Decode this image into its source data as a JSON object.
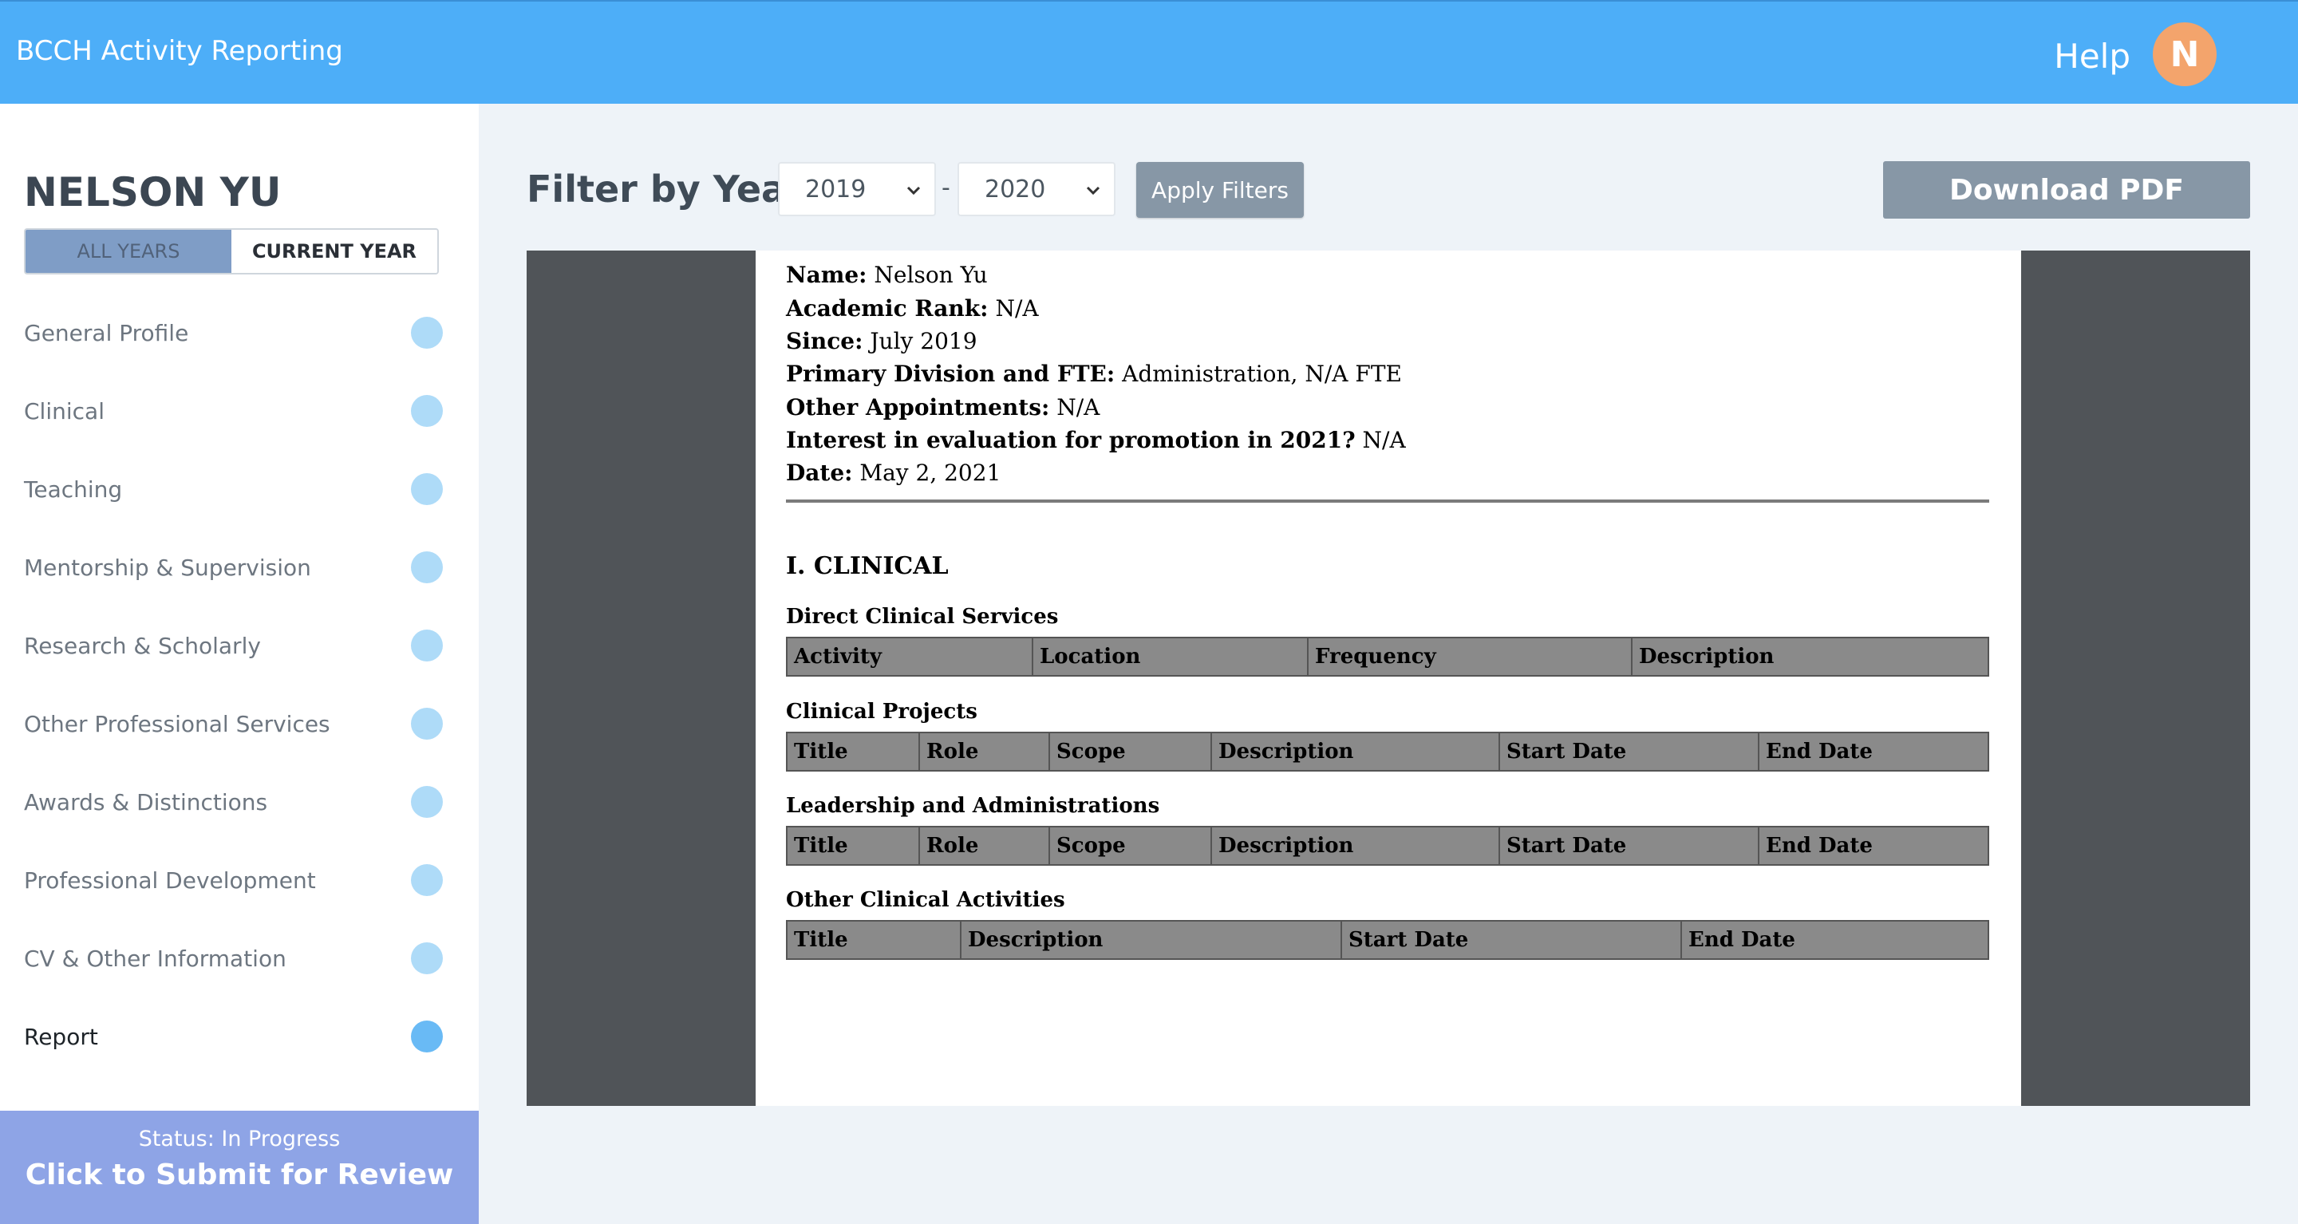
{
  "app": {
    "title": "BCCH Activity Reporting",
    "help_label": "Help",
    "avatar_initial": "N"
  },
  "sidebar": {
    "user_name": "NELSON YU",
    "toggle": {
      "all_years": "ALL YEARS",
      "current_year": "CURRENT YEAR"
    },
    "items": [
      {
        "label": "General Profile"
      },
      {
        "label": "Clinical"
      },
      {
        "label": "Teaching"
      },
      {
        "label": "Mentorship & Supervision"
      },
      {
        "label": "Research & Scholarly"
      },
      {
        "label": "Other Professional Services"
      },
      {
        "label": "Awards & Distinctions"
      },
      {
        "label": "Professional Development"
      },
      {
        "label": "CV & Other Information"
      },
      {
        "label": "Report"
      }
    ],
    "status": "Status: In Progress",
    "submit_label": "Click to Submit for Review"
  },
  "filter": {
    "label": "Filter by Year:",
    "from_year": "2019",
    "separator": "-",
    "to_year": "2020",
    "apply_label": "Apply Filters"
  },
  "download_label": "Download PDF",
  "report": {
    "info": [
      {
        "label": "Name:",
        "value": "Nelson Yu"
      },
      {
        "label": "Academic Rank:",
        "value": "N/A"
      },
      {
        "label": "Since:",
        "value": "July 2019"
      },
      {
        "label": "Primary Division and FTE:",
        "value": "Administration, N/A FTE"
      },
      {
        "label": "Other Appointments:",
        "value": "N/A"
      },
      {
        "label": "Interest in evaluation for promotion in 2021?",
        "value": "N/A"
      },
      {
        "label": "Date:",
        "value": "May 2, 2021"
      }
    ],
    "section_title": "I. CLINICAL",
    "tables": [
      {
        "title": "Direct Clinical Services",
        "columns": [
          "Activity",
          "Location",
          "Frequency",
          "Description"
        ]
      },
      {
        "title": "Clinical Projects",
        "columns": [
          "Title",
          "Role",
          "Scope",
          "Description",
          "Start Date",
          "End Date"
        ]
      },
      {
        "title": "Leadership and Administrations",
        "columns": [
          "Title",
          "Role",
          "Scope",
          "Description",
          "Start Date",
          "End Date"
        ]
      },
      {
        "title": "Other Clinical Activities",
        "columns": [
          "Title",
          "Description",
          "Start Date",
          "End Date"
        ]
      }
    ]
  }
}
